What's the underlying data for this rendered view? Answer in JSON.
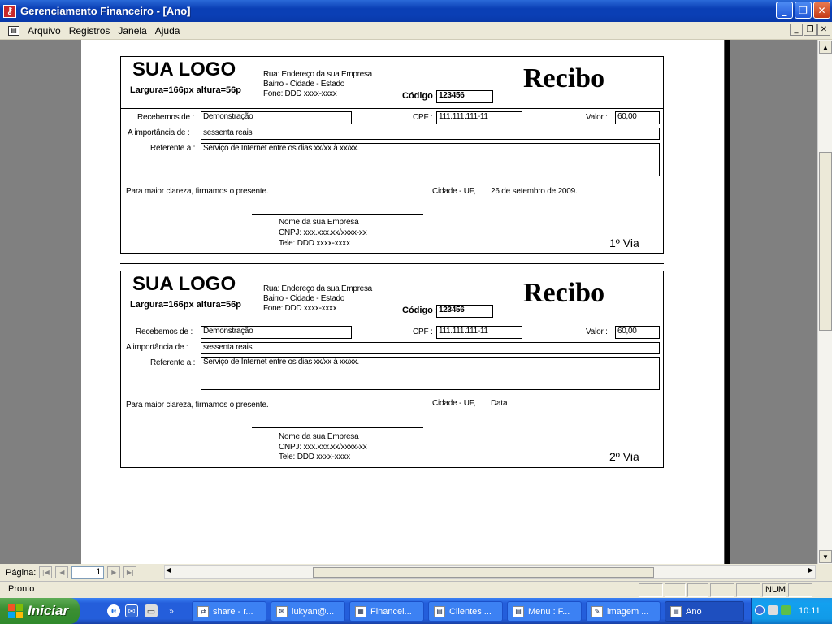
{
  "window": {
    "title": "Gerenciamento Financeiro - [Ano]"
  },
  "menu": {
    "items": [
      "Arquivo",
      "Registros",
      "Janela",
      "Ajuda"
    ]
  },
  "receipts": [
    {
      "logo": "SUA LOGO",
      "logo_size": "Largura=166px  altura=56p",
      "address": [
        "Rua: Endereço da sua Empresa",
        "Bairro - Cidade - Estado",
        "Fone: DDD xxxx-xxxx"
      ],
      "codigo_label": "Código :",
      "codigo": "123456",
      "heading": "Recibo",
      "recebemos_label": "Recebemos de :",
      "recebemos": "Demonstração",
      "cpf_label": "CPF :",
      "cpf": "111.111.111-11",
      "valor_label": "Valor :",
      "valor": "60,00",
      "importancia_label": "A importância de :",
      "importancia": "sessenta reais",
      "referente_label": "Referente a :",
      "referente": "Serviço de Internet entre os dias xx/xx à xx/xx.",
      "clareza": "Para maior clareza, firmamos o presente.",
      "cidade": "Cidade - UF,",
      "data": "26 de setembro de 2009.",
      "empresa": [
        "Nome da sua Empresa",
        "CNPJ: xxx.xxx.xx/xxxx-xx",
        "Tele: DDD xxxx-xxxx"
      ],
      "via": "1º Via"
    },
    {
      "logo": "SUA LOGO",
      "logo_size": "Largura=166px  altura=56p",
      "address": [
        "Rua: Endereço da sua Empresa",
        "Bairro - Cidade - Estado",
        "Fone: DDD xxxx-xxxx"
      ],
      "codigo_label": "Código :",
      "codigo": "123456",
      "heading": "Recibo",
      "recebemos_label": "Recebemos de :",
      "recebemos": "Demonstração",
      "cpf_label": "CPF :",
      "cpf": "111.111.111-11",
      "valor_label": "Valor :",
      "valor": "60,00",
      "importancia_label": "A importância de :",
      "importancia": "sessenta reais",
      "referente_label": "Referente a :",
      "referente": "Serviço de Internet entre os dias xx/xx à xx/xx.",
      "clareza": "Para maior clareza, firmamos o presente.",
      "cidade": "Cidade - UF,",
      "data": "Data",
      "empresa": [
        "Nome da sua Empresa",
        "CNPJ: xxx.xxx.xx/xxxx-xx",
        "Tele: DDD xxxx-xxxx"
      ],
      "via": "2º Via"
    }
  ],
  "navigation": {
    "label": "Página:",
    "page": "1"
  },
  "status": {
    "text": "Pronto",
    "num": "NUM"
  },
  "taskbar": {
    "start": "Iniciar",
    "tasks": [
      "share - r...",
      "lukyan@...",
      "Financei...",
      "Clientes ...",
      "Menu : F...",
      "imagem ...",
      "Ano"
    ],
    "clock": "10:11"
  }
}
